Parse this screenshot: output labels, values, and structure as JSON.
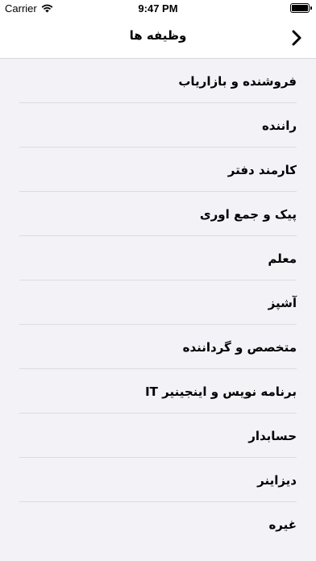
{
  "status_bar": {
    "carrier": "Carrier",
    "time": "9:47 PM"
  },
  "nav": {
    "title": "وظیفه ها"
  },
  "items": [
    {
      "label": "فروشنده و بازاریاب"
    },
    {
      "label": "راننده"
    },
    {
      "label": "کارمند دفتر"
    },
    {
      "label": "پیک و جمع اوری"
    },
    {
      "label": "معلم"
    },
    {
      "label": "آشپز"
    },
    {
      "label": "متخصص و گرداننده"
    },
    {
      "label": "برنامه نویس و اینجینیر IT"
    },
    {
      "label": "حسابدار"
    },
    {
      "label": "دیزاینر"
    },
    {
      "label": "غیره"
    }
  ]
}
